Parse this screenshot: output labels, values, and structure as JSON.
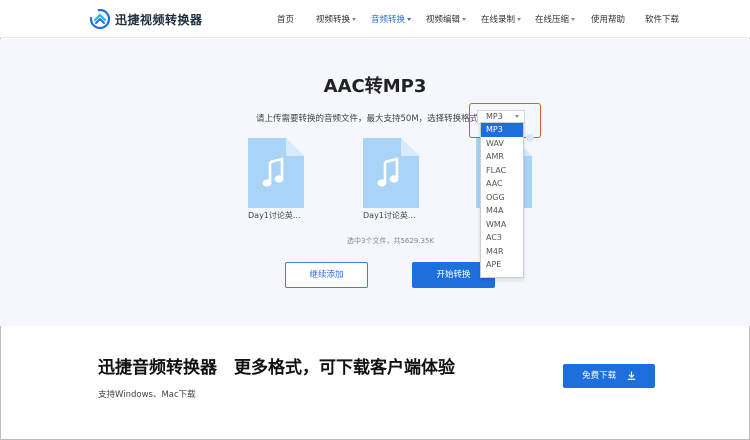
{
  "header": {
    "brand": "迅捷视频转换器",
    "nav": [
      {
        "label": "首页",
        "has_arrow": false,
        "active": false
      },
      {
        "label": "视频转换",
        "has_arrow": true,
        "active": false
      },
      {
        "label": "音频转换",
        "has_arrow": true,
        "active": true
      },
      {
        "label": "视频编辑",
        "has_arrow": true,
        "active": false
      },
      {
        "label": "在线录制",
        "has_arrow": true,
        "active": false
      },
      {
        "label": "在线压缩",
        "has_arrow": true,
        "active": false
      },
      {
        "label": "使用帮助",
        "has_arrow": false,
        "active": false
      },
      {
        "label": "软件下载",
        "has_arrow": false,
        "active": false
      }
    ]
  },
  "converter": {
    "title": "AAC转MP3",
    "prompt": "请上传需要转换的音频文件，最大支持50M，选择转换格式：",
    "format_select": {
      "value": "MP3",
      "options": [
        "MP3",
        "WAV",
        "AMR",
        "FLAC",
        "AAC",
        "OGG",
        "M4A",
        "WMA",
        "AC3",
        "M4R",
        "APE"
      ],
      "selected_index": 0
    },
    "files": [
      {
        "name": "Day1讨论英..."
      },
      {
        "name": "Day1讨论英..."
      }
    ],
    "stats": "选中3个文件，共5629.35K",
    "add_button": "继续添加",
    "start_button": "开始转换"
  },
  "promo": {
    "title": "迅捷音频转换器　更多格式，可下载客户端体验",
    "subtitle": "支持Windows、Mac下载",
    "download_button": "免费下载"
  },
  "colors": {
    "accent": "#1e6fde",
    "highlight": "#e0554b",
    "icon_light": "#a9d3f7",
    "page_bg": "#f4f7fc"
  }
}
